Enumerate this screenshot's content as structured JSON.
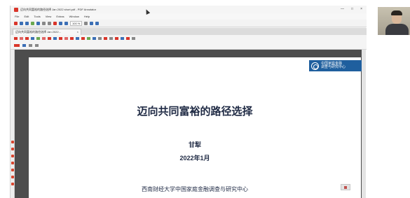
{
  "window": {
    "title": "迈向共同富裕的路径选择 Jan 2022 short.pdf - PDF Annotator",
    "controls": [
      "—",
      "□",
      "×"
    ]
  },
  "menu": [
    "File",
    "Edit",
    "Tools",
    "View",
    "Extras",
    "Window",
    "Help"
  ],
  "toolbar": {
    "zoom_label": "100 %",
    "icon_colors": [
      "#d9352a",
      "#3b6fb6",
      "#3b6fb6",
      "#6aa84f",
      "#3b6fb6",
      "#888888",
      "#888888",
      "#d9352a",
      "#3b6fb6",
      "#3b6fb6",
      "#888888",
      "#3b6fb6",
      "#3b6fb6"
    ]
  },
  "tab": {
    "label": "迈向共同富裕的路径选择 Jan 2022...",
    "close": "×"
  },
  "annotation_toolbar": {
    "icon_colors": [
      "#d9352a",
      "#e06666",
      "#d9352a",
      "#3b6fb6",
      "#6aa84f",
      "#e06666",
      "#d9352a",
      "#3b6fb6",
      "#d9352a",
      "#e06666",
      "#d9352a",
      "#3b6fb6",
      "#d9352a",
      "#6aa84f",
      "#3b6fb6",
      "#888888",
      "#d9352a",
      "#888888",
      "#d9352a",
      "#3b6fb6",
      "#d9352a",
      "#888888"
    ]
  },
  "slide": {
    "logo_line1": "中国家庭金融",
    "logo_line2": "调查与研究中心",
    "title": "迈向共同富裕的路径选择",
    "author": "甘犁",
    "date": "2022年1月",
    "institution": "西南财经大学中国家庭金融调查与研究中心"
  },
  "colors": {
    "accent": "#1f5f9e",
    "slide_text": "#1f2a44",
    "canvas_bg": "#4d4d4d",
    "app_icon": "#d9352a"
  }
}
